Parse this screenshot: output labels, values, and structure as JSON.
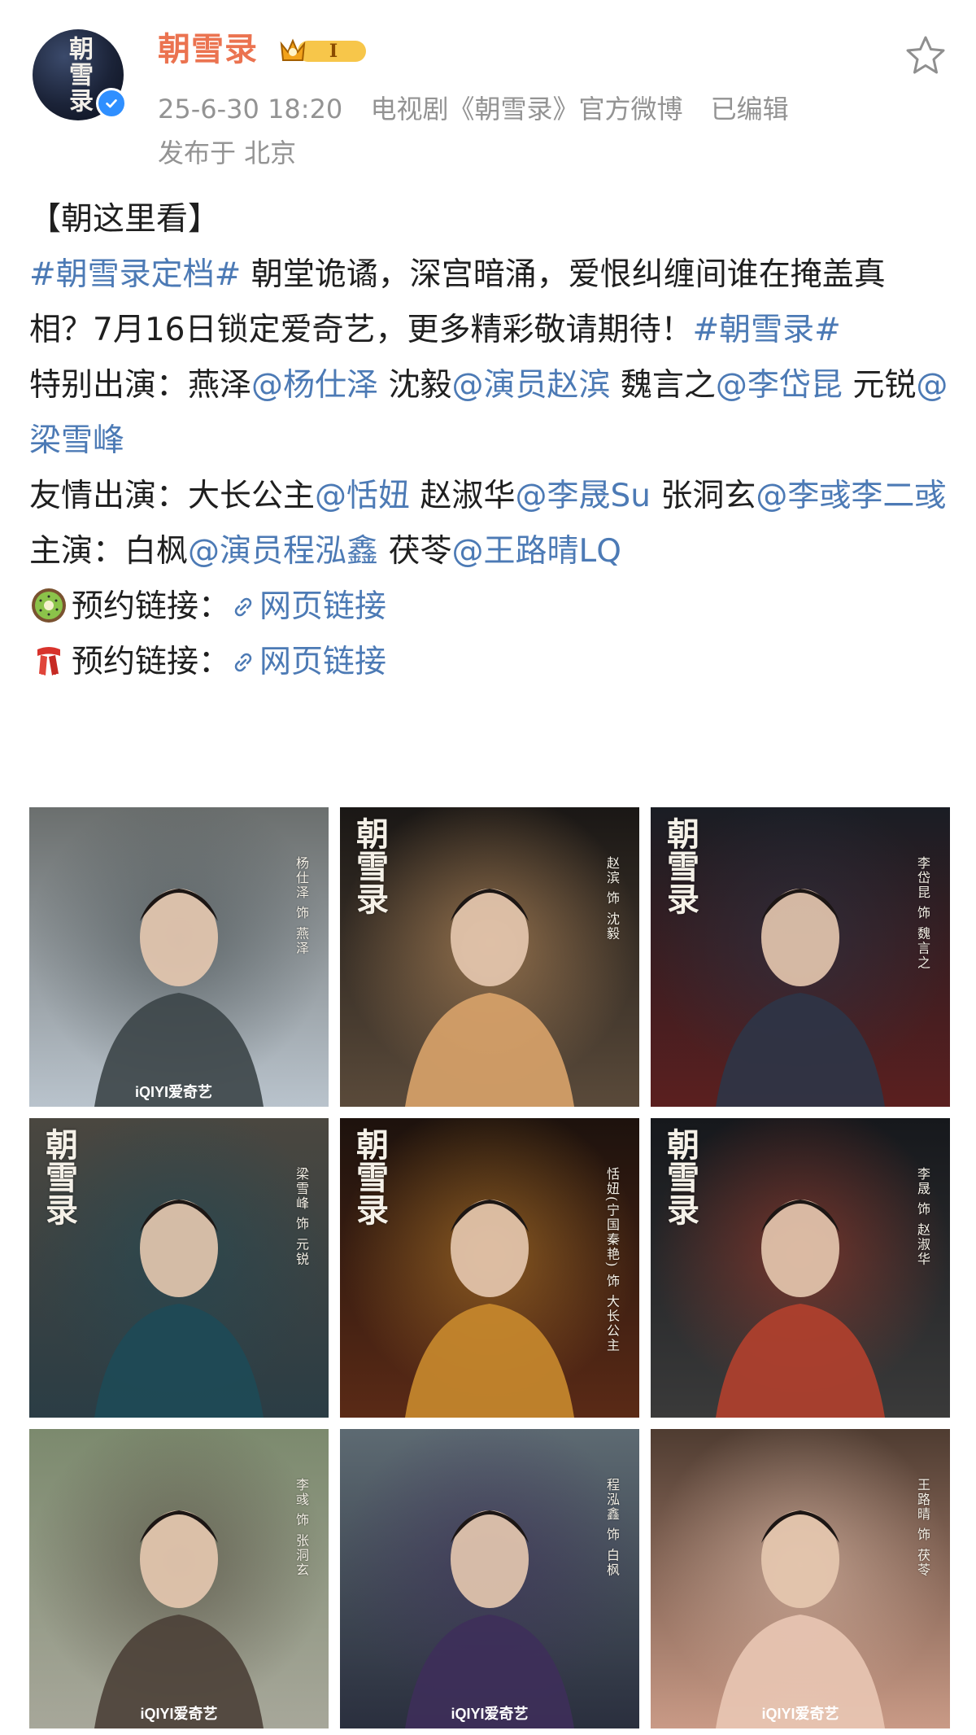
{
  "header": {
    "avatar_text": "朝雪录",
    "username": "朝雪录",
    "vip_level": "I",
    "timestamp": "25-6-30 18:20",
    "source": "电视剧《朝雪录》官方微博",
    "edited": "已编辑",
    "location": "发布于 北京"
  },
  "post": {
    "heading": "【朝这里看】",
    "hashtag": "#朝雪录定档#",
    "body_1": "朝堂诡谲，深宫暗涌，爱恨纠缠间谁在掩盖真相？7月16日锁定爱奇艺，更多精彩敬请期待！",
    "hashtag_2": "#朝雪录#",
    "special_label": "特别出演：",
    "special": [
      {
        "role": "燕泽",
        "mention": "@杨仕泽"
      },
      {
        "role": "沈毅",
        "mention": "@演员赵滨"
      },
      {
        "role": "魏言之",
        "mention": "@李岱昆"
      },
      {
        "role": "元锐",
        "mention": "@梁雪峰"
      }
    ],
    "friend_label": "友情出演：",
    "friend": [
      {
        "role": "大长公主",
        "mention": "@恬妞"
      },
      {
        "role": "赵淑华",
        "mention": "@李晟Su"
      },
      {
        "role": "张洞玄",
        "mention": "@李彧李二彧"
      }
    ],
    "lead_label": "主演：",
    "lead": [
      {
        "role": "白枫",
        "mention": "@演员程泓鑫"
      },
      {
        "role": "茯苓",
        "mention": "@王路晴LQ"
      }
    ],
    "reserve_1_label": "预约链接：",
    "reserve_1_link": "网页链接",
    "reserve_2_label": "预约链接：",
    "reserve_2_link": "网页链接"
  },
  "images": [
    {
      "caption": "杨仕泽 饰 燕泽",
      "logo": "",
      "brand": "iQIYI爱奇艺",
      "palette": [
        "#6b6f6e",
        "#b9c3cc",
        "#3c4548"
      ]
    },
    {
      "caption": "赵滨 饰 沈毅",
      "logo": "朝雪录",
      "brand": "",
      "palette": [
        "#1a1715",
        "#5a4a3a",
        "#d9a36a"
      ]
    },
    {
      "caption": "李岱昆 饰 魏言之",
      "logo": "朝雪录",
      "brand": "",
      "palette": [
        "#1a1d24",
        "#5b1f1f",
        "#2e3547"
      ]
    },
    {
      "caption": "梁雪峰 饰 元锐",
      "logo": "朝雪录",
      "brand": "",
      "palette": [
        "#4a4740",
        "#2b3d45",
        "#1e4a57"
      ]
    },
    {
      "caption": "恬妞(宁国秦艳) 饰 大长公主",
      "logo": "朝雪录",
      "brand": "",
      "palette": [
        "#1d120d",
        "#5a2a16",
        "#c9892e"
      ]
    },
    {
      "caption": "李晟 饰 赵淑华",
      "logo": "朝雪录",
      "brand": "",
      "palette": [
        "#16181c",
        "#3a3a3a",
        "#b3402e"
      ]
    },
    {
      "caption": "李彧 饰 张洞玄",
      "logo": "",
      "brand": "iQIYI爱奇艺",
      "palette": [
        "#7c8a6e",
        "#a7a79a",
        "#4b4037"
      ]
    },
    {
      "caption": "程泓鑫 饰 白枫",
      "logo": "",
      "brand": "iQIYI爱奇艺",
      "palette": [
        "#5d6a72",
        "#2a2f3e",
        "#3e2f5a"
      ]
    },
    {
      "caption": "王路晴 饰 茯苓",
      "logo": "",
      "brand": "iQIYI爱奇艺",
      "palette": [
        "#4f3c31",
        "#c99a86",
        "#e9c7b4"
      ]
    }
  ],
  "colors": {
    "username": "#eb7350",
    "link": "#4c7ab5",
    "meta": "#939393"
  },
  "icons": [
    "verified-icon",
    "vip-badge-icon",
    "star-icon",
    "kiwi-icon",
    "scarf-icon",
    "link-icon"
  ]
}
